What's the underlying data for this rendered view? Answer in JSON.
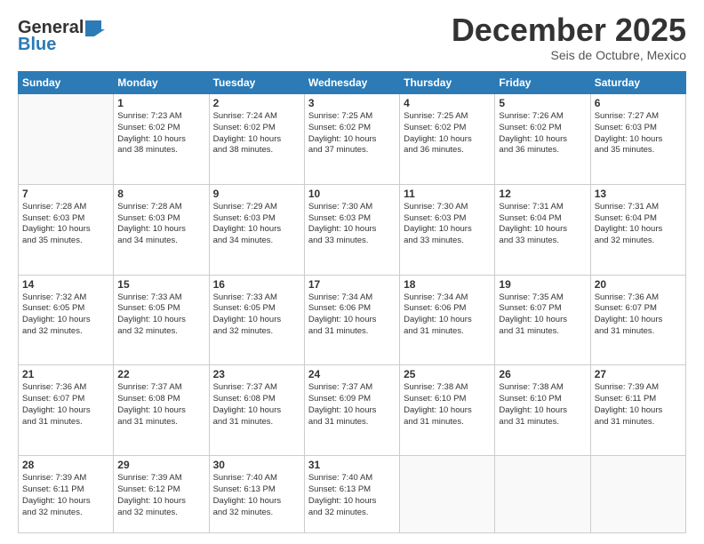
{
  "logo": {
    "line1": "General",
    "line2": "Blue"
  },
  "header": {
    "month_year": "December 2025",
    "location": "Seis de Octubre, Mexico"
  },
  "days_of_week": [
    "Sunday",
    "Monday",
    "Tuesday",
    "Wednesday",
    "Thursday",
    "Friday",
    "Saturday"
  ],
  "weeks": [
    [
      {
        "num": "",
        "info": ""
      },
      {
        "num": "1",
        "info": "Sunrise: 7:23 AM\nSunset: 6:02 PM\nDaylight: 10 hours\nand 38 minutes."
      },
      {
        "num": "2",
        "info": "Sunrise: 7:24 AM\nSunset: 6:02 PM\nDaylight: 10 hours\nand 38 minutes."
      },
      {
        "num": "3",
        "info": "Sunrise: 7:25 AM\nSunset: 6:02 PM\nDaylight: 10 hours\nand 37 minutes."
      },
      {
        "num": "4",
        "info": "Sunrise: 7:25 AM\nSunset: 6:02 PM\nDaylight: 10 hours\nand 36 minutes."
      },
      {
        "num": "5",
        "info": "Sunrise: 7:26 AM\nSunset: 6:02 PM\nDaylight: 10 hours\nand 36 minutes."
      },
      {
        "num": "6",
        "info": "Sunrise: 7:27 AM\nSunset: 6:03 PM\nDaylight: 10 hours\nand 35 minutes."
      }
    ],
    [
      {
        "num": "7",
        "info": "Sunrise: 7:28 AM\nSunset: 6:03 PM\nDaylight: 10 hours\nand 35 minutes."
      },
      {
        "num": "8",
        "info": "Sunrise: 7:28 AM\nSunset: 6:03 PM\nDaylight: 10 hours\nand 34 minutes."
      },
      {
        "num": "9",
        "info": "Sunrise: 7:29 AM\nSunset: 6:03 PM\nDaylight: 10 hours\nand 34 minutes."
      },
      {
        "num": "10",
        "info": "Sunrise: 7:30 AM\nSunset: 6:03 PM\nDaylight: 10 hours\nand 33 minutes."
      },
      {
        "num": "11",
        "info": "Sunrise: 7:30 AM\nSunset: 6:03 PM\nDaylight: 10 hours\nand 33 minutes."
      },
      {
        "num": "12",
        "info": "Sunrise: 7:31 AM\nSunset: 6:04 PM\nDaylight: 10 hours\nand 33 minutes."
      },
      {
        "num": "13",
        "info": "Sunrise: 7:31 AM\nSunset: 6:04 PM\nDaylight: 10 hours\nand 32 minutes."
      }
    ],
    [
      {
        "num": "14",
        "info": "Sunrise: 7:32 AM\nSunset: 6:05 PM\nDaylight: 10 hours\nand 32 minutes."
      },
      {
        "num": "15",
        "info": "Sunrise: 7:33 AM\nSunset: 6:05 PM\nDaylight: 10 hours\nand 32 minutes."
      },
      {
        "num": "16",
        "info": "Sunrise: 7:33 AM\nSunset: 6:05 PM\nDaylight: 10 hours\nand 32 minutes."
      },
      {
        "num": "17",
        "info": "Sunrise: 7:34 AM\nSunset: 6:06 PM\nDaylight: 10 hours\nand 31 minutes."
      },
      {
        "num": "18",
        "info": "Sunrise: 7:34 AM\nSunset: 6:06 PM\nDaylight: 10 hours\nand 31 minutes."
      },
      {
        "num": "19",
        "info": "Sunrise: 7:35 AM\nSunset: 6:07 PM\nDaylight: 10 hours\nand 31 minutes."
      },
      {
        "num": "20",
        "info": "Sunrise: 7:36 AM\nSunset: 6:07 PM\nDaylight: 10 hours\nand 31 minutes."
      }
    ],
    [
      {
        "num": "21",
        "info": "Sunrise: 7:36 AM\nSunset: 6:07 PM\nDaylight: 10 hours\nand 31 minutes."
      },
      {
        "num": "22",
        "info": "Sunrise: 7:37 AM\nSunset: 6:08 PM\nDaylight: 10 hours\nand 31 minutes."
      },
      {
        "num": "23",
        "info": "Sunrise: 7:37 AM\nSunset: 6:08 PM\nDaylight: 10 hours\nand 31 minutes."
      },
      {
        "num": "24",
        "info": "Sunrise: 7:37 AM\nSunset: 6:09 PM\nDaylight: 10 hours\nand 31 minutes."
      },
      {
        "num": "25",
        "info": "Sunrise: 7:38 AM\nSunset: 6:10 PM\nDaylight: 10 hours\nand 31 minutes."
      },
      {
        "num": "26",
        "info": "Sunrise: 7:38 AM\nSunset: 6:10 PM\nDaylight: 10 hours\nand 31 minutes."
      },
      {
        "num": "27",
        "info": "Sunrise: 7:39 AM\nSunset: 6:11 PM\nDaylight: 10 hours\nand 31 minutes."
      }
    ],
    [
      {
        "num": "28",
        "info": "Sunrise: 7:39 AM\nSunset: 6:11 PM\nDaylight: 10 hours\nand 32 minutes."
      },
      {
        "num": "29",
        "info": "Sunrise: 7:39 AM\nSunset: 6:12 PM\nDaylight: 10 hours\nand 32 minutes."
      },
      {
        "num": "30",
        "info": "Sunrise: 7:40 AM\nSunset: 6:13 PM\nDaylight: 10 hours\nand 32 minutes."
      },
      {
        "num": "31",
        "info": "Sunrise: 7:40 AM\nSunset: 6:13 PM\nDaylight: 10 hours\nand 32 minutes."
      },
      {
        "num": "",
        "info": ""
      },
      {
        "num": "",
        "info": ""
      },
      {
        "num": "",
        "info": ""
      }
    ]
  ]
}
